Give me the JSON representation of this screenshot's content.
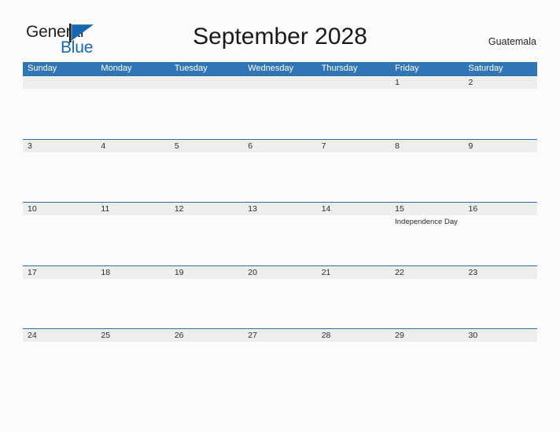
{
  "logo": {
    "word_one": "General",
    "word_two": "Blue",
    "triangle_icon": "triangle-flag-icon",
    "accent_color": "#1567b2"
  },
  "header": {
    "title": "September 2028",
    "country": "Guatemala"
  },
  "calendar": {
    "header_bg": "#3075b5",
    "band_bg": "#eeeeee",
    "band_border": "#2e6da8",
    "day_names": [
      "Sunday",
      "Monday",
      "Tuesday",
      "Wednesday",
      "Thursday",
      "Friday",
      "Saturday"
    ],
    "weeks": [
      {
        "days": [
          {
            "date": "",
            "event": ""
          },
          {
            "date": "",
            "event": ""
          },
          {
            "date": "",
            "event": ""
          },
          {
            "date": "",
            "event": ""
          },
          {
            "date": "",
            "event": ""
          },
          {
            "date": "1",
            "event": ""
          },
          {
            "date": "2",
            "event": ""
          }
        ]
      },
      {
        "days": [
          {
            "date": "3",
            "event": ""
          },
          {
            "date": "4",
            "event": ""
          },
          {
            "date": "5",
            "event": ""
          },
          {
            "date": "6",
            "event": ""
          },
          {
            "date": "7",
            "event": ""
          },
          {
            "date": "8",
            "event": ""
          },
          {
            "date": "9",
            "event": ""
          }
        ]
      },
      {
        "days": [
          {
            "date": "10",
            "event": ""
          },
          {
            "date": "11",
            "event": ""
          },
          {
            "date": "12",
            "event": ""
          },
          {
            "date": "13",
            "event": ""
          },
          {
            "date": "14",
            "event": ""
          },
          {
            "date": "15",
            "event": "Independence Day"
          },
          {
            "date": "16",
            "event": ""
          }
        ]
      },
      {
        "days": [
          {
            "date": "17",
            "event": ""
          },
          {
            "date": "18",
            "event": ""
          },
          {
            "date": "19",
            "event": ""
          },
          {
            "date": "20",
            "event": ""
          },
          {
            "date": "21",
            "event": ""
          },
          {
            "date": "22",
            "event": ""
          },
          {
            "date": "23",
            "event": ""
          }
        ]
      },
      {
        "days": [
          {
            "date": "24",
            "event": ""
          },
          {
            "date": "25",
            "event": ""
          },
          {
            "date": "26",
            "event": ""
          },
          {
            "date": "27",
            "event": ""
          },
          {
            "date": "28",
            "event": ""
          },
          {
            "date": "29",
            "event": ""
          },
          {
            "date": "30",
            "event": ""
          }
        ]
      }
    ]
  }
}
